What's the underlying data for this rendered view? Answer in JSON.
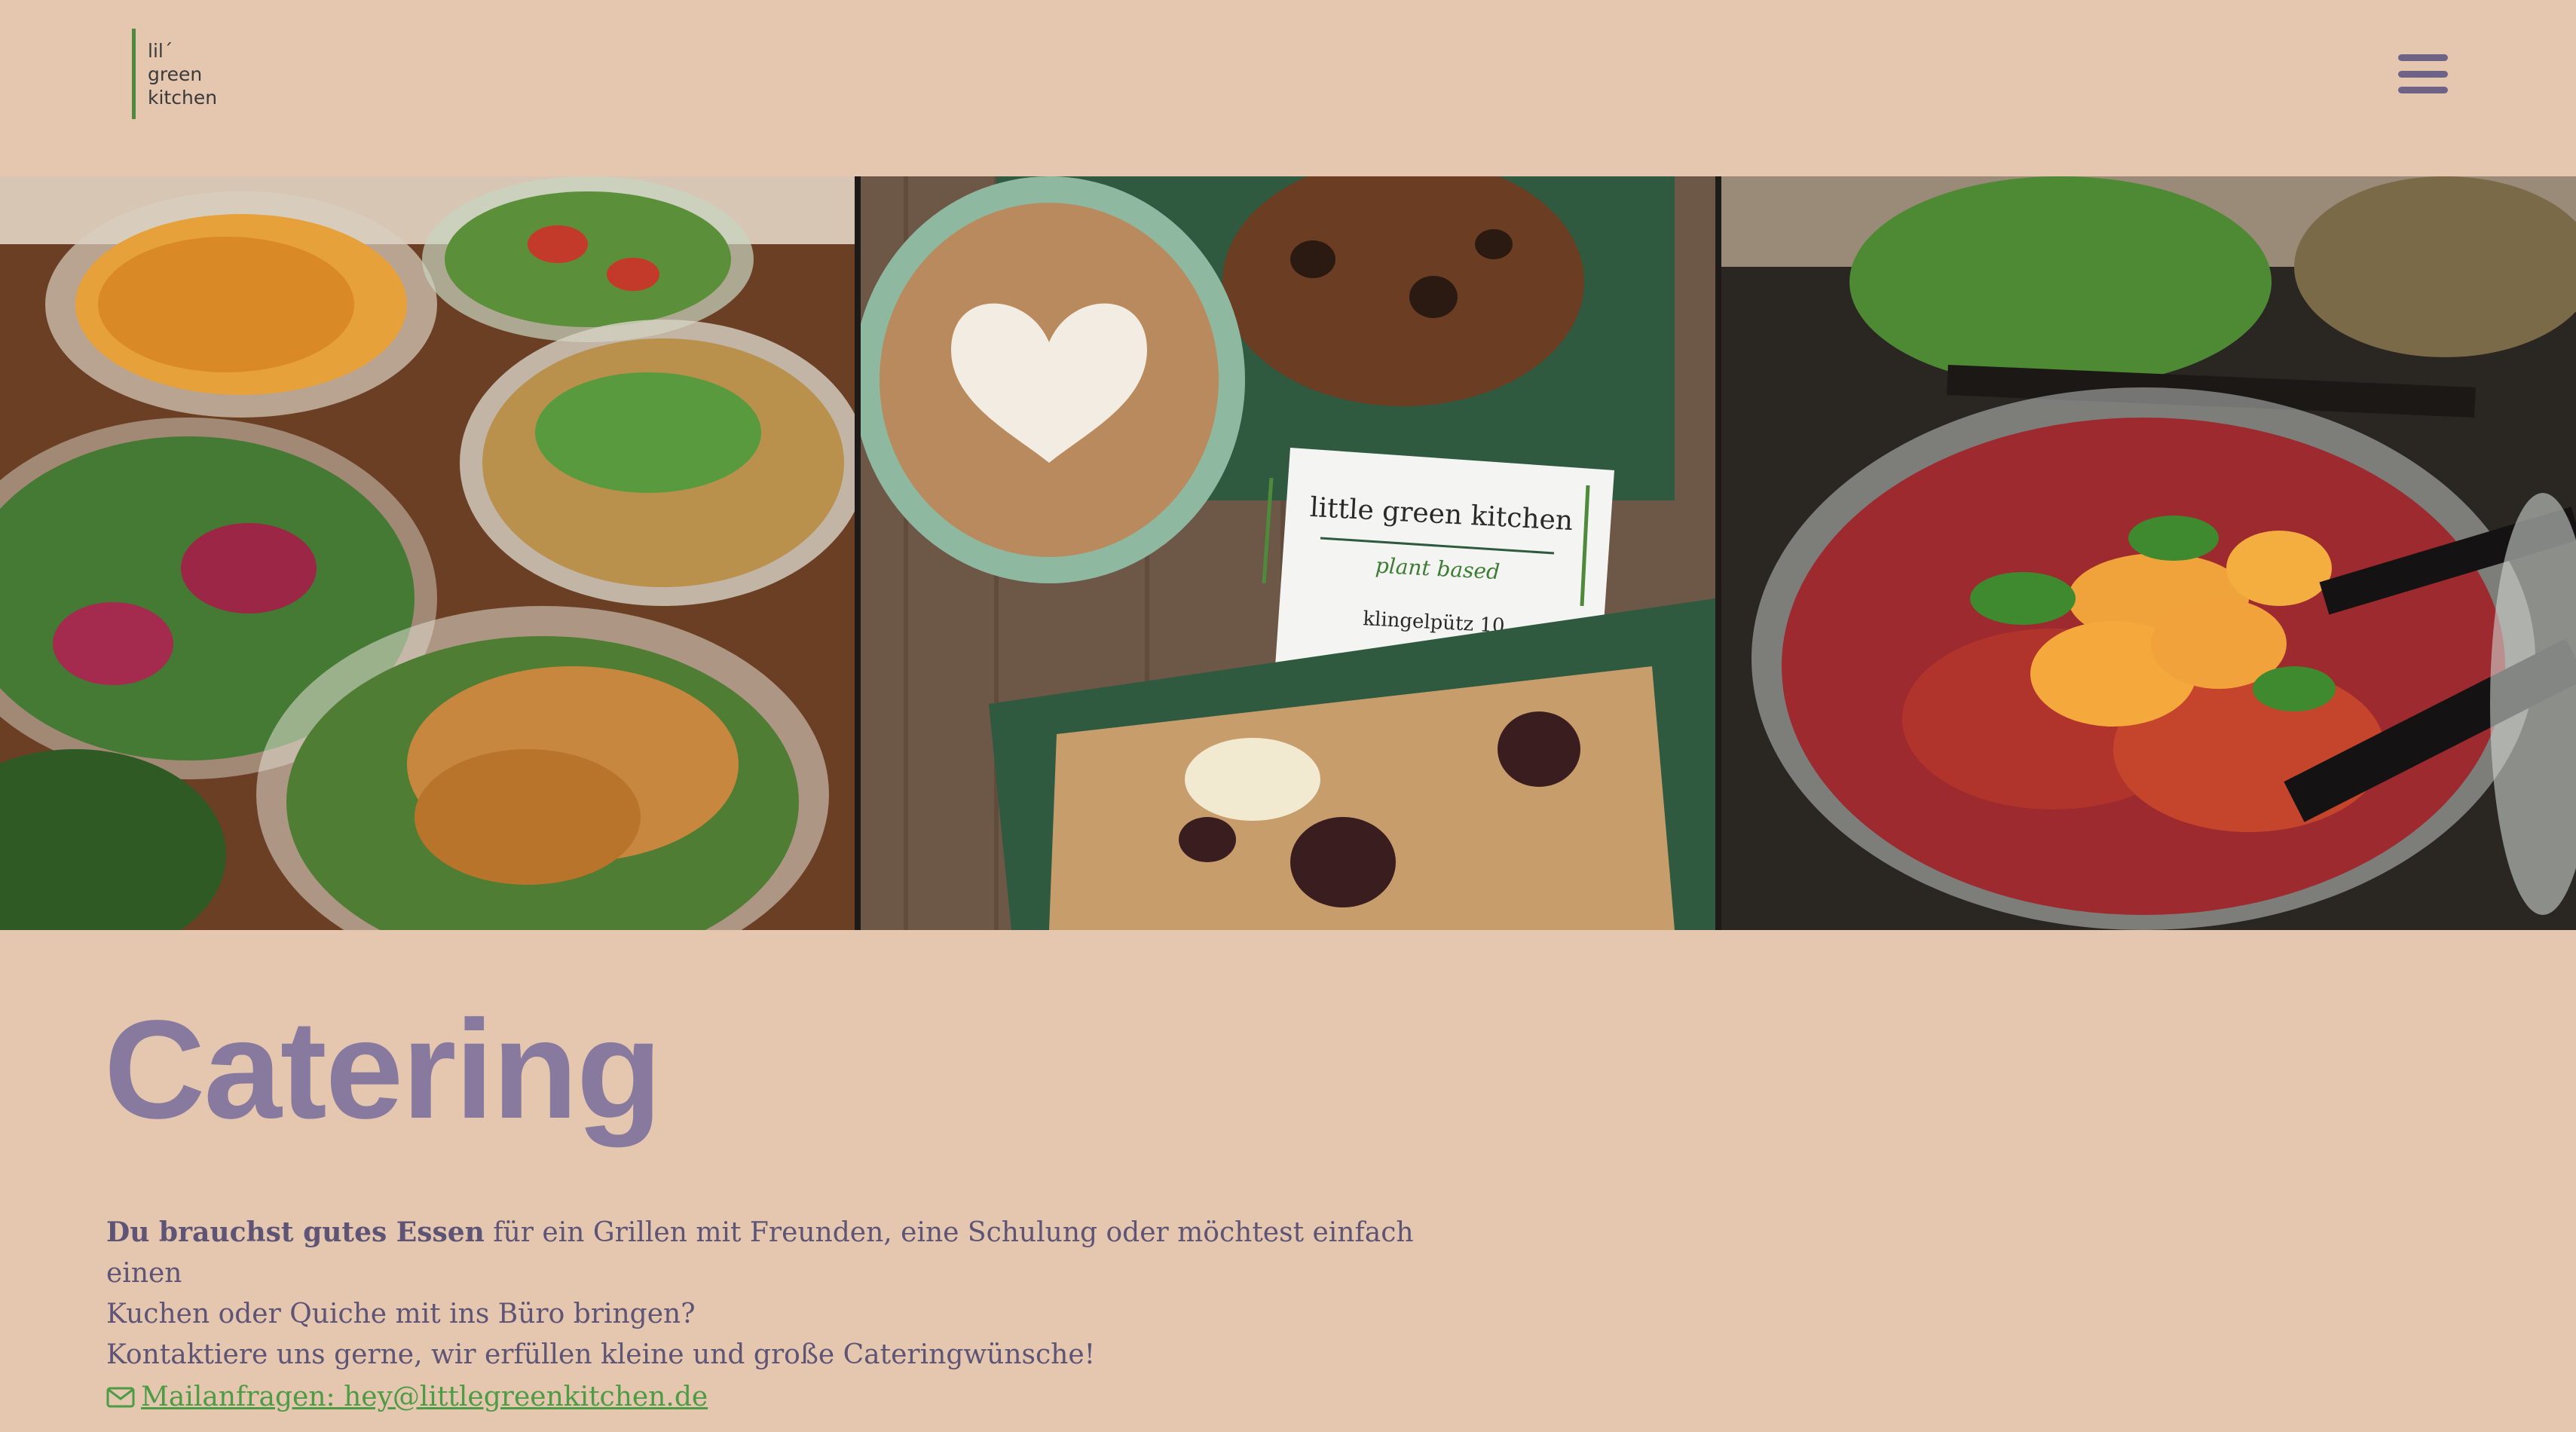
{
  "header": {
    "logo_lines": [
      "lil´",
      "green",
      "kitchen"
    ],
    "menu_icon": "hamburger-menu-icon"
  },
  "gallery": {
    "photo_1": "salad-bowls-photo",
    "photo_2": "coffee-and-cake-photo",
    "photo_3": "orange-beet-salad-photo",
    "card": {
      "name": "little green kitchen",
      "tagline": "plant based",
      "address": "klingelpütz 10"
    }
  },
  "main": {
    "title": "Catering",
    "intro_bold": "Du brauchst gutes Essen",
    "intro_line1_rest": " für ein Grillen mit Freunden, eine Schulung oder möchtest einfach einen",
    "intro_line2": "Kuchen oder Quiche mit ins Büro bringen?",
    "intro_line3": "Kontaktiere uns gerne, wir erfüllen kleine und große Cateringwünsche!",
    "mail_icon": "envelope-icon",
    "mail_label": " Mailanfragen: hey@littlegreenkitchen.de"
  },
  "colors": {
    "background": "#e5c6af",
    "title": "#887a9e",
    "text": "#5d5476",
    "link": "#4d9c45",
    "logo_bar": "#4f8a3c"
  }
}
